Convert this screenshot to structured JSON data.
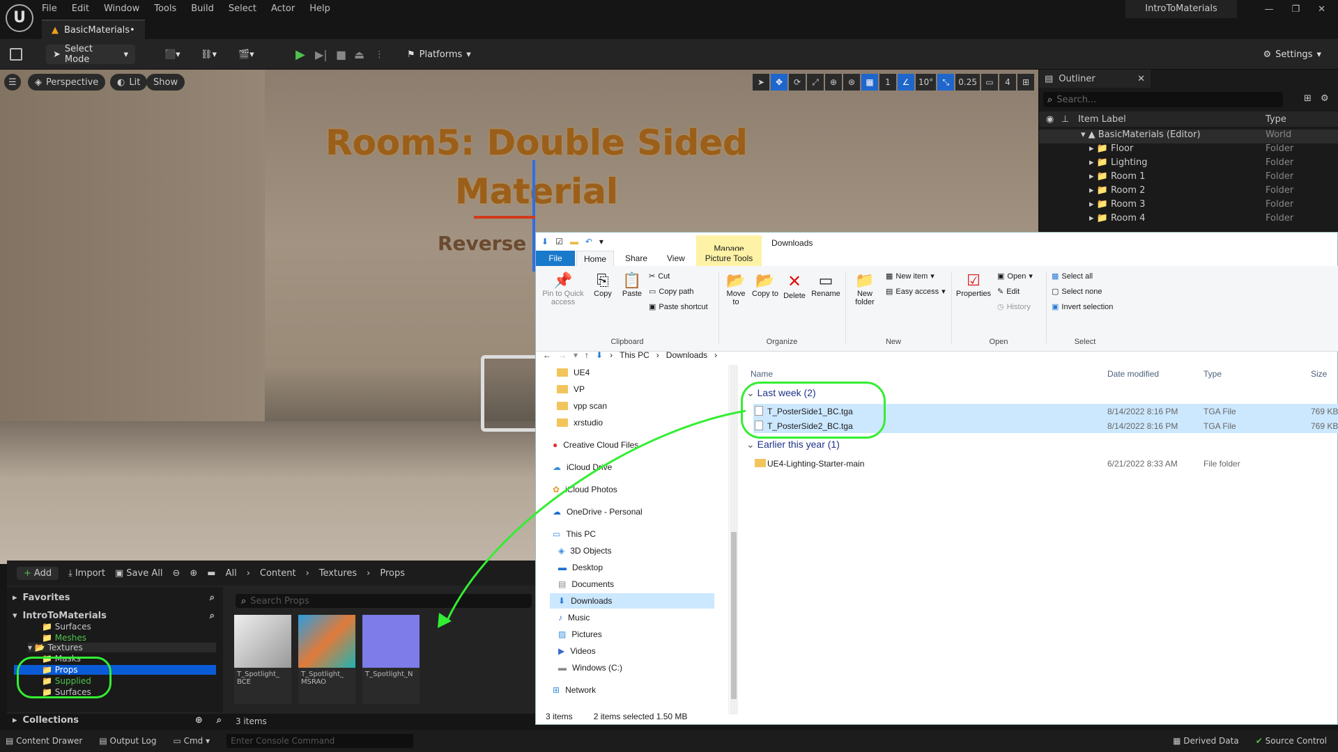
{
  "menu": [
    "File",
    "Edit",
    "Window",
    "Tools",
    "Build",
    "Select",
    "Actor",
    "Help"
  ],
  "project_name": "IntroToMaterials",
  "level_tab": "BasicMaterials•",
  "toolbar": {
    "select_mode": "Select Mode",
    "platforms": "Platforms",
    "settings": "Settings"
  },
  "viewport": {
    "perspective": "Perspective",
    "lit": "Lit",
    "show": "Show",
    "grid_snap": "1",
    "rotation_snap": "10°",
    "scale_snap": "0.25",
    "camera_speed": "4",
    "title_line1": "Room5: Double Sided",
    "title_line2": "Material",
    "subtitle": "Reverse B"
  },
  "outliner": {
    "title": "Outliner",
    "search_placeholder": "Search...",
    "col_label": "Item Label",
    "col_type": "Type",
    "items": [
      {
        "label": "BasicMaterials (Editor)",
        "type": "World"
      },
      {
        "label": "Floor",
        "type": "Folder"
      },
      {
        "label": "Lighting",
        "type": "Folder"
      },
      {
        "label": "Room 1",
        "type": "Folder"
      },
      {
        "label": "Room 2",
        "type": "Folder"
      },
      {
        "label": "Room 3",
        "type": "Folder"
      },
      {
        "label": "Room 4",
        "type": "Folder"
      }
    ]
  },
  "content_browser": {
    "add": "Add",
    "import": "Import",
    "save_all": "Save All",
    "path": [
      "All",
      "Content",
      "Textures",
      "Props"
    ],
    "favorites": "Favorites",
    "project": "IntroToMaterials",
    "collections": "Collections",
    "search_placeholder": "Search Props",
    "tree": [
      "Surfaces",
      "Meshes",
      "Textures",
      "Masks",
      "Props",
      "Supplied",
      "Surfaces"
    ],
    "assets": [
      {
        "name": "T_Spotlight_ BCE",
        "color": "#d8d8d8"
      },
      {
        "name": "T_Spotlight_ MSRAO",
        "color": "#e07a3a"
      },
      {
        "name": "T_Spotlight_N",
        "color": "#7d7ce8"
      }
    ],
    "count": "3 items"
  },
  "bottom_bar": {
    "content_drawer": "Content Drawer",
    "output_log": "Output Log",
    "cmd": "Cmd",
    "console_placeholder": "Enter Console Command",
    "derived_data": "Derived Data",
    "source_control": "Source Control"
  },
  "explorer": {
    "title": "Downloads",
    "manage": "Manage",
    "tabs": [
      "File",
      "Home",
      "Share",
      "View",
      "Picture Tools"
    ],
    "ribbon": {
      "pin": "Pin to Quick access",
      "copy": "Copy",
      "paste": "Paste",
      "cut": "Cut",
      "copy_path": "Copy path",
      "paste_shortcut": "Paste shortcut",
      "move_to": "Move to",
      "copy_to": "Copy to",
      "delete": "Delete",
      "rename": "Rename",
      "new_folder": "New folder",
      "new_item": "New item",
      "easy_access": "Easy access",
      "properties": "Properties",
      "open": "Open",
      "edit": "Edit",
      "history": "History",
      "select_all": "Select all",
      "select_none": "Select none",
      "invert_selection": "Invert selection",
      "groups": [
        "Clipboard",
        "Organize",
        "New",
        "Open",
        "Select"
      ]
    },
    "breadcrumb": [
      "This PC",
      "Downloads"
    ],
    "nav_items": [
      "UE4",
      "VP",
      "vpp scan",
      "xrstudio",
      "Creative Cloud Files",
      "iCloud Drive",
      "iCloud Photos",
      "OneDrive - Personal",
      "This PC",
      "3D Objects",
      "Desktop",
      "Documents",
      "Downloads",
      "Music",
      "Pictures",
      "Videos",
      "Windows (C:)",
      "Network"
    ],
    "columns": [
      "Name",
      "Date modified",
      "Type",
      "Size"
    ],
    "group_last_week": "Last week (2)",
    "group_earlier": "Earlier this year (1)",
    "files": [
      {
        "name": "T_PosterSide1_BC.tga",
        "date": "8/14/2022 8:16 PM",
        "type": "TGA File",
        "size": "769 KB"
      },
      {
        "name": "T_PosterSide2_BC.tga",
        "date": "8/14/2022 8:16 PM",
        "type": "TGA File",
        "size": "769 KB"
      },
      {
        "name": "UE4-Lighting-Starter-main",
        "date": "6/21/2022 8:33 AM",
        "type": "File folder",
        "size": ""
      }
    ],
    "status_items": "3 items",
    "status_selected": "2 items selected  1.50 MB"
  },
  "annotation_color": "#33ee33"
}
